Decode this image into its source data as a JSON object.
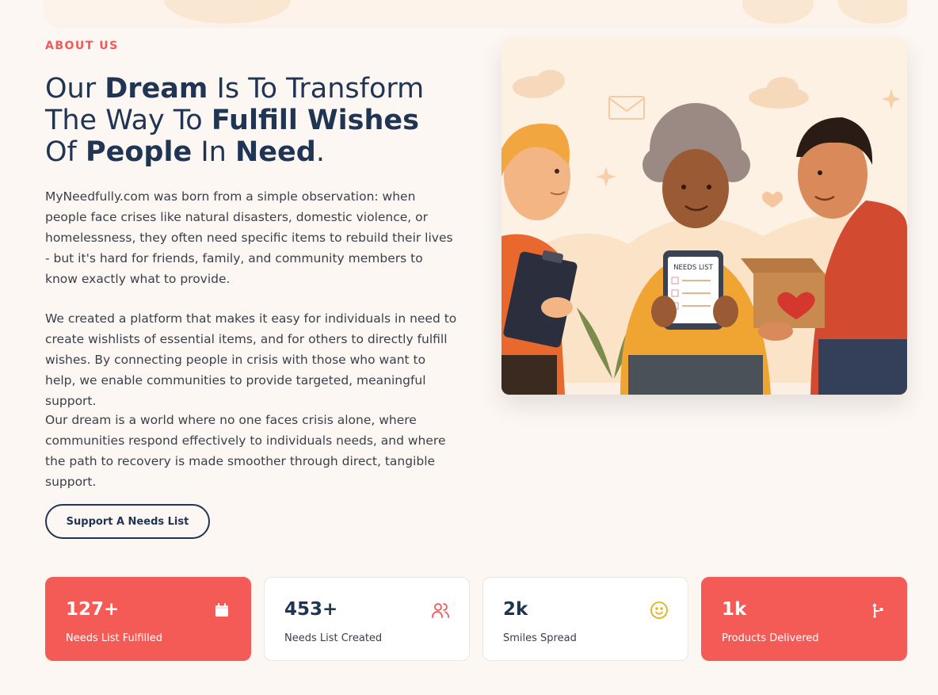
{
  "section": {
    "eyebrow": "ABOUT US"
  },
  "headline": {
    "l1a": "Our ",
    "l1b": "Dream",
    "l1c": " Is To Transform",
    "l2a": "The Way To ",
    "l2b": "Fulfill Wishes",
    "l3a": "Of ",
    "l3b": "People",
    "l3c": " In ",
    "l3d": "Need",
    "l3e": "."
  },
  "paragraphs": [
    "MyNeedfully.com was born from a simple observation: when people face crises like natural disasters, domestic violence, or homelessness, they often need specific items to rebuild their lives - but it's hard for friends, family, and community members to know exactly what to provide.",
    "We created a platform that makes it easy for individuals in need to create wishlists of essential items, and for others to directly fulfill wishes. By connecting people in crisis with those who want to help, we enable communities to provide targeted, meaningful support.",
    "Our dream is a world where no one faces crisis alone, where communities respond effectively to individuals needs, and where the path to recovery is made smoother through direct, tangible support."
  ],
  "cta": {
    "label": "Support A Needs List"
  },
  "illustration": {
    "tablet_text": "NEEDS LIST"
  },
  "stats": [
    {
      "value": "127+",
      "label": "Needs List Fulfilled",
      "icon": "calendar-icon",
      "style": "red"
    },
    {
      "value": "453+",
      "label": "Needs List Created",
      "icon": "users-icon",
      "style": "white"
    },
    {
      "value": "2k",
      "label": "Smiles Spread",
      "icon": "smile-icon",
      "style": "white"
    },
    {
      "value": "1k",
      "label": "Products Delivered",
      "icon": "dolly-icon",
      "style": "red"
    }
  ],
  "colors": {
    "accent": "#f45b57",
    "navy": "#1f3553",
    "background": "#fdf7f3",
    "smile_icon": "#e2b21c"
  }
}
